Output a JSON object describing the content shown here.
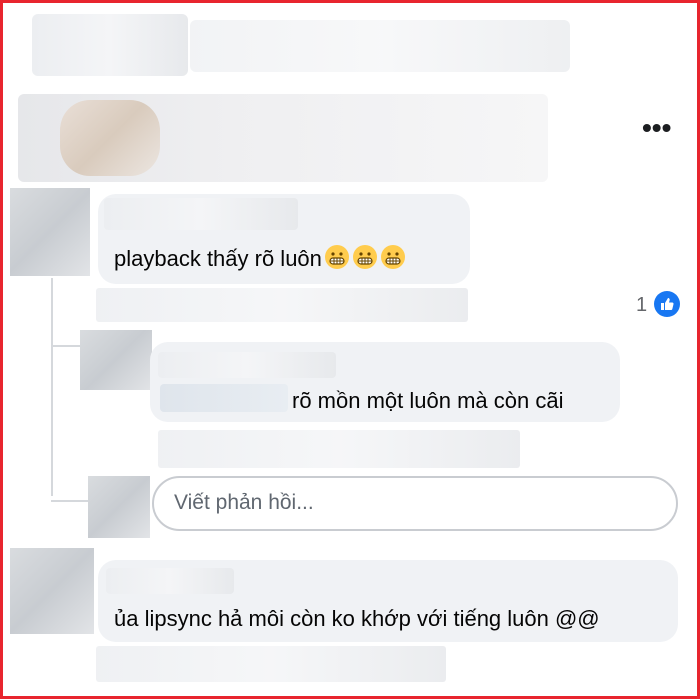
{
  "post": {
    "more_icon": "ellipsis-horizontal-icon",
    "more_glyph": "•••"
  },
  "comments": [
    {
      "text": "playback thấy rõ luôn",
      "emojis": [
        "grimacing-face-icon",
        "grimacing-face-icon",
        "grimacing-face-icon"
      ],
      "reaction_count": "1",
      "reaction_icon": "like-icon"
    },
    {
      "text": "rõ mồn một luôn mà còn cãi"
    },
    {
      "text": "ủa lipsync hả môi còn ko khớp với tiếng luôn @@"
    }
  ],
  "reply_box": {
    "placeholder": "Viết phản hồi..."
  },
  "colors": {
    "frame": "#e8252e",
    "bubble": "#f0f2f5",
    "like": "#1877f2"
  }
}
